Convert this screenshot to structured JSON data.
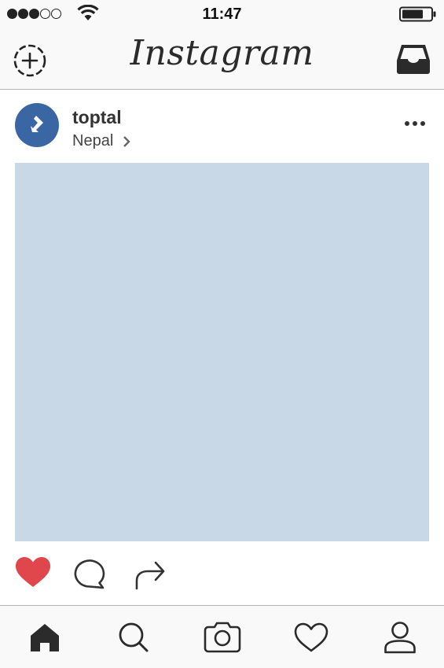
{
  "status_bar": {
    "time": "11:47",
    "signal_bars_filled": 3,
    "signal_bars_total": 5
  },
  "header": {
    "logo_text": "Instagram",
    "left_icon": "new-post-icon",
    "right_icon": "inbox-icon"
  },
  "post": {
    "username": "toptal",
    "location": "Nepal",
    "image_placeholder_color": "#c8d8e7",
    "liked": true
  },
  "actions": [
    "heart-icon",
    "comment-icon",
    "share-icon"
  ],
  "tab_bar": {
    "tabs": [
      "home-icon",
      "search-icon",
      "camera-icon",
      "activity-heart-icon",
      "profile-icon"
    ],
    "active": "home-icon"
  },
  "colors": {
    "accent_like": "#e0474c",
    "avatar": "#3a67a3",
    "text": "#333333",
    "bar_background": "#f9f9f9"
  }
}
